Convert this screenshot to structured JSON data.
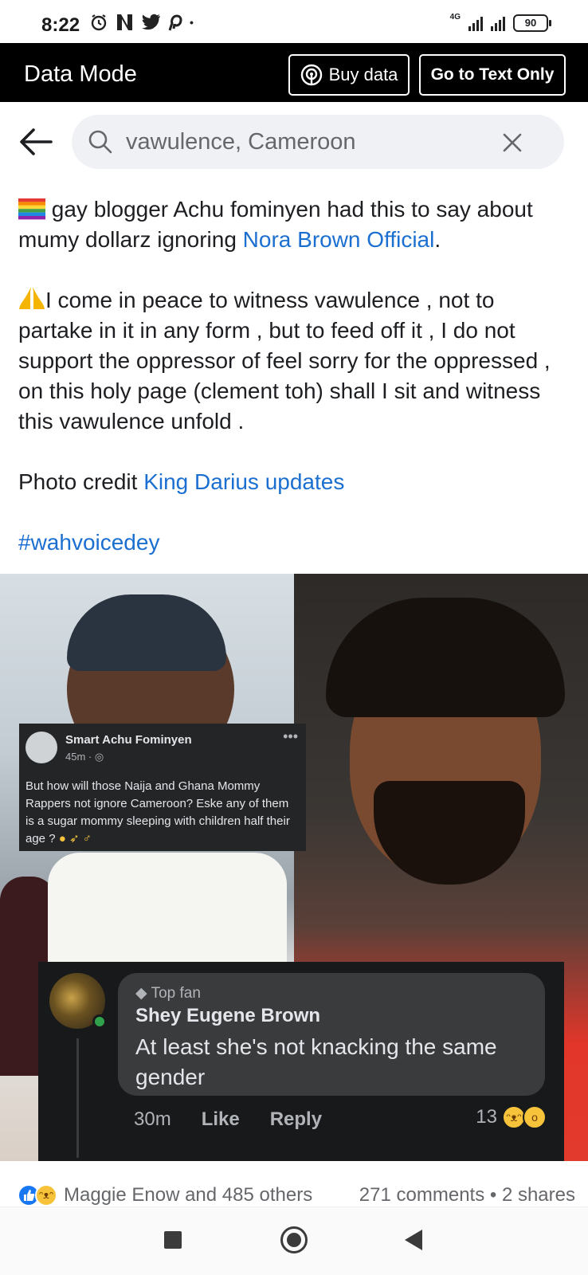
{
  "status_bar": {
    "time": "8:22",
    "left_icons": [
      "alarm-icon",
      "netflix-icon",
      "twitter-icon",
      "pinterest-icon"
    ],
    "network_label": "4G",
    "battery": "90"
  },
  "data_mode_bar": {
    "title": "Data Mode",
    "buy_data_label": "Buy data",
    "text_only_label": "Go to Text Only"
  },
  "search": {
    "query": "vawulence, Cameroon"
  },
  "post": {
    "line1_prefix": "gay blogger Achu fominyen   had this to say about  mumy dollarz ignoring ",
    "line1_link": "Nora Brown Official",
    "line1_suffix": ".",
    "paragraph2": "I come in peace to witness vawulence , not to partake in it in any form , but to feed off it , I do not support the oppressor of feel sorry for the oppressed , on this holy page (clement toh) shall I sit and witness this vawulence unfold .",
    "photo_credit_label": "Photo credit ",
    "photo_credit_link": "King Darius updates",
    "hashtag": "#wahvoicedey"
  },
  "embedded_post": {
    "author": "Smart Achu Fominyen",
    "time": "45m ·",
    "text": "But how will those Naija and Ghana Mommy Rappers not ignore Cameroon? Eske any of them is a sugar mommy sleeping with children half their age ?"
  },
  "embedded_comment": {
    "badge": "Top fan",
    "author": "Shey Eugene Brown",
    "text": "At least she's not knacking the same gender",
    "time": "30m",
    "like_label": "Like",
    "reply_label": "Reply",
    "reaction_count": "13"
  },
  "reactions": {
    "reactors": "Maggie Enow and 485 others",
    "comments_shares": "271 comments • 2 shares"
  },
  "colors": {
    "link": "#1b6fd0",
    "data_bar": "#000000",
    "search_bg": "#eff1f4"
  }
}
